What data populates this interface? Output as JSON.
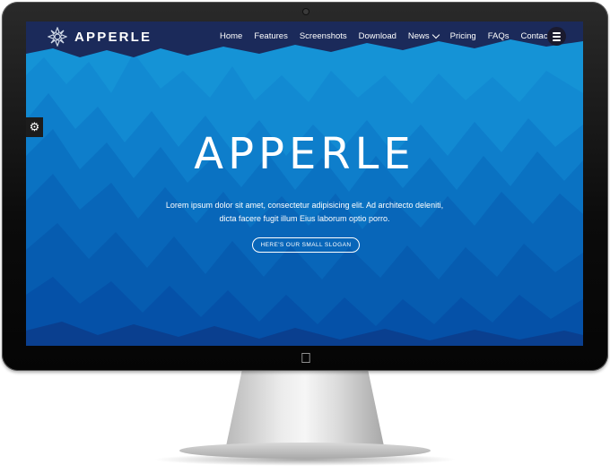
{
  "brand": {
    "name": "APPERLE"
  },
  "nav": {
    "items": [
      {
        "label": "Home"
      },
      {
        "label": "Features"
      },
      {
        "label": "Screenshots"
      },
      {
        "label": "Download"
      },
      {
        "label": "News"
      },
      {
        "label": "Pricing"
      },
      {
        "label": "FAQs"
      },
      {
        "label": "Contact"
      }
    ],
    "menu_icon": "hamburger-icon"
  },
  "settings_tab": {
    "icon": "gear-icon"
  },
  "hero": {
    "title": "APPERLE",
    "text": "Lorem ipsum dolor sit amet, consectetur adipisicing elit. Ad architecto deleniti, dicta facere fugit illum Eius laborum optio porro.",
    "button_label": "HERE'S OUR SMALL SLOGAN"
  },
  "colors": {
    "bg_light": "#1593d6",
    "bg_mid": "#0b72c4",
    "bg_dark": "#0750a8",
    "nav_dark": "#1b2a5a"
  }
}
